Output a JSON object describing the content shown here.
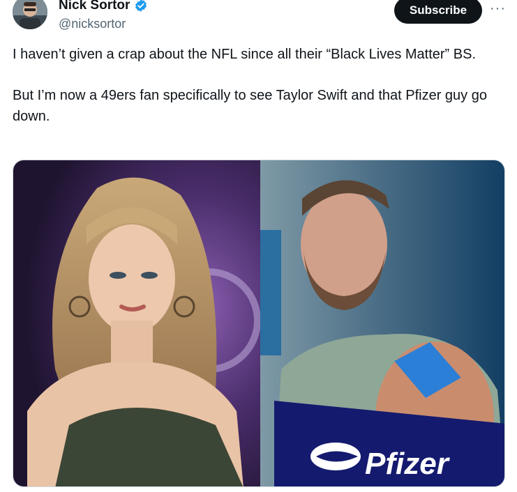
{
  "author": {
    "display_name": "Nick Sortor",
    "handle": "@nicksortor"
  },
  "actions": {
    "subscribe_label": "Subscribe",
    "more_label": "···"
  },
  "tweet": {
    "paragraphs": [
      "I haven’t given a crap about the NFL since all their “Black Lives Matter” BS.",
      "But I’m now a 49ers fan specifically to see Taylor Swift and that Pfizer guy go down."
    ]
  },
  "media": {
    "right_image_logo_text": "Pfizer"
  },
  "colors": {
    "verified": "#1d9bf0",
    "text": "#0f1419",
    "secondary_text": "#536471",
    "pfizer_banner": "#141a6e"
  },
  "icons": [
    "verified-badge-icon",
    "more-options-icon"
  ]
}
